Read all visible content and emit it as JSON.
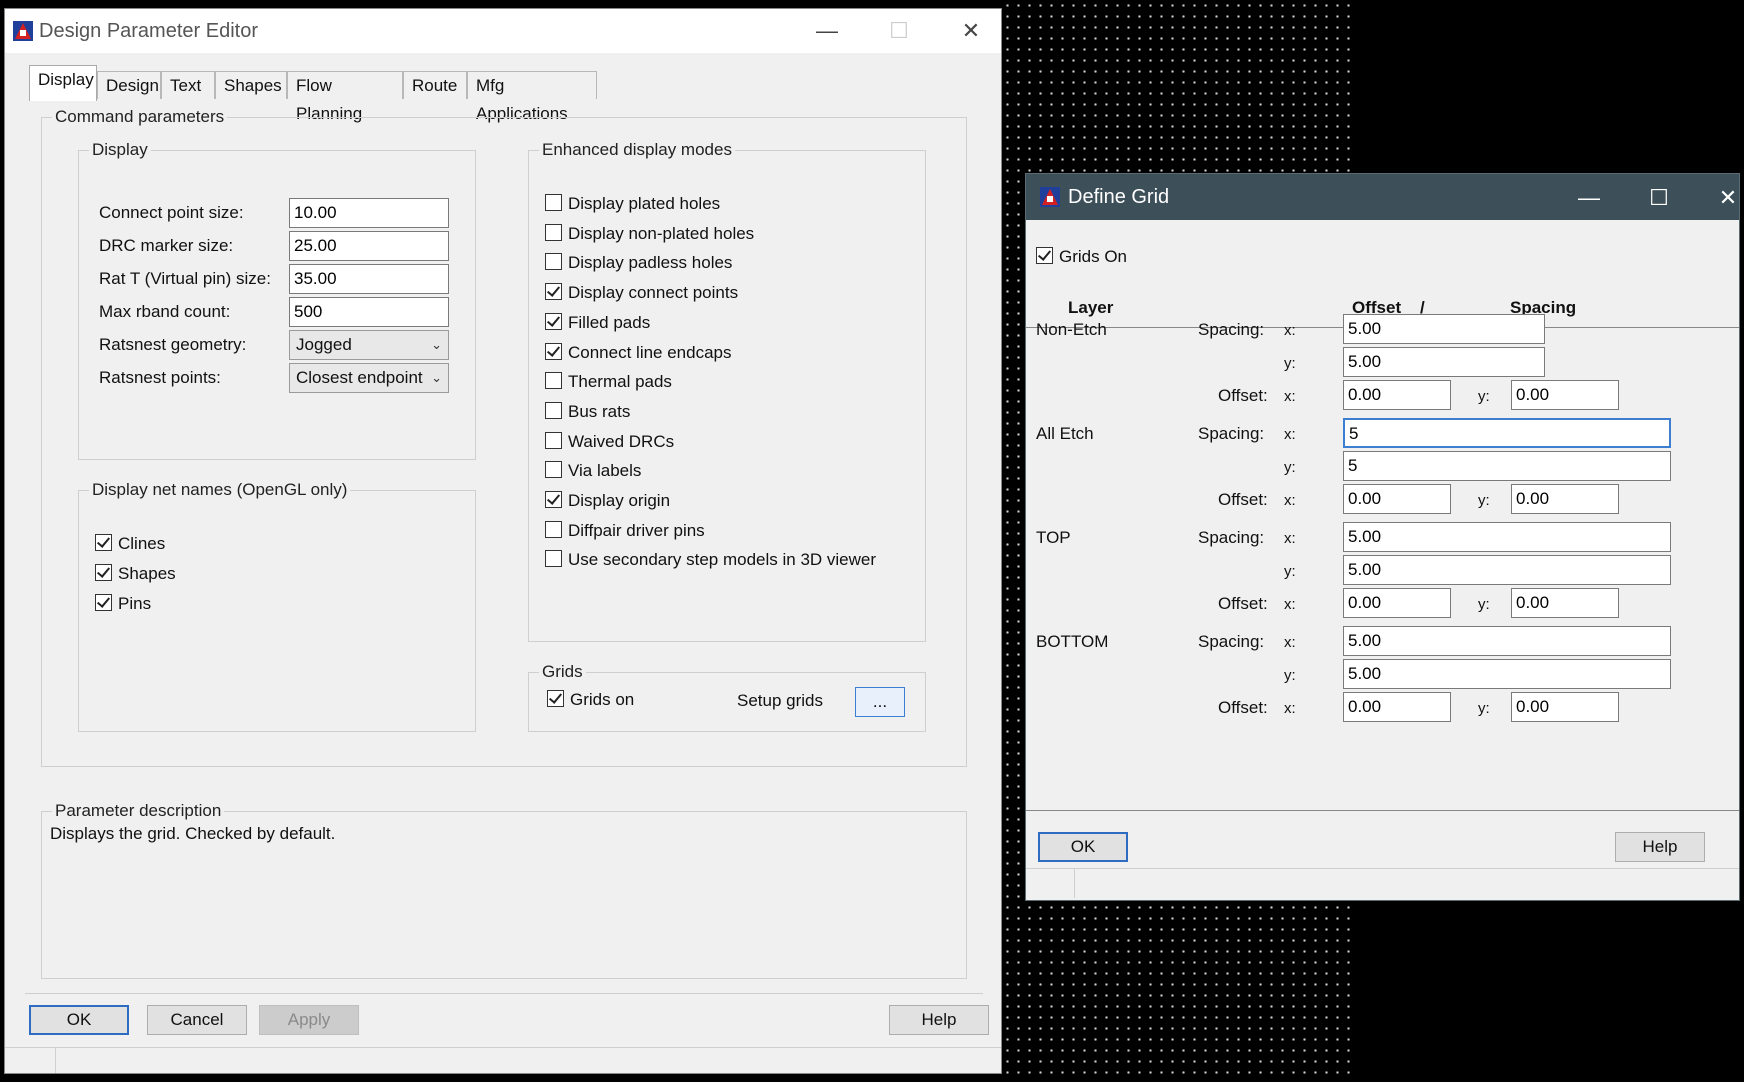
{
  "main": {
    "title": "Design Parameter Editor",
    "tabs": [
      "Display",
      "Design",
      "Text",
      "Shapes",
      "Flow Planning",
      "Route",
      "Mfg Applications"
    ],
    "command_group": "Command parameters",
    "display_group": "Display",
    "fields": {
      "connect_point_label": "Connect point size:",
      "connect_point_value": "10.00",
      "drc_marker_label": "DRC marker size:",
      "drc_marker_value": "25.00",
      "rat_t_label": "Rat T (Virtual pin) size:",
      "rat_t_value": "35.00",
      "max_rband_label": "Max rband count:",
      "max_rband_value": "500",
      "ratsnest_geom_label": "Ratsnest geometry:",
      "ratsnest_geom_value": "Jogged",
      "ratsnest_points_label": "Ratsnest points:",
      "ratsnest_points_value": "Closest endpoint"
    },
    "net_names_group": "Display net names (OpenGL only)",
    "net_names": [
      {
        "label": "Clines",
        "checked": true
      },
      {
        "label": "Shapes",
        "checked": true
      },
      {
        "label": "Pins",
        "checked": true
      }
    ],
    "enhanced_group": "Enhanced display modes",
    "enhanced": [
      {
        "label": "Display plated holes",
        "checked": false
      },
      {
        "label": "Display non-plated holes",
        "checked": false
      },
      {
        "label": "Display padless holes",
        "checked": false
      },
      {
        "label": "Display connect points",
        "checked": true
      },
      {
        "label": "Filled pads",
        "checked": true
      },
      {
        "label": "Connect line endcaps",
        "checked": true
      },
      {
        "label": "Thermal pads",
        "checked": false
      },
      {
        "label": "Bus rats",
        "checked": false
      },
      {
        "label": "Waived DRCs",
        "checked": false
      },
      {
        "label": "Via labels",
        "checked": false
      },
      {
        "label": "Display origin",
        "checked": true
      },
      {
        "label": "Diffpair driver pins",
        "checked": false
      },
      {
        "label": "Use secondary step models in 3D viewer",
        "checked": false
      }
    ],
    "grids_group": "Grids",
    "grids_on_label": "Grids on",
    "grids_on_checked": true,
    "setup_grids_label": "Setup grids",
    "setup_grids_button": "...",
    "param_desc_group": "Parameter description",
    "param_desc_text": "Displays the grid. Checked by default.",
    "buttons": {
      "ok": "OK",
      "cancel": "Cancel",
      "apply": "Apply",
      "help": "Help"
    }
  },
  "grid": {
    "title": "Define Grid",
    "grids_on_label": "Grids On",
    "grids_on_checked": true,
    "header_layer": "Layer",
    "header_offset": "Offset",
    "header_slash": "/",
    "header_spacing": "Spacing",
    "spacing_label": "Spacing:",
    "offset_label": "Offset:",
    "x_label": "x:",
    "y_label": "y:",
    "layers": [
      {
        "name": "Non-Etch",
        "spacing_x": "5.00",
        "spacing_y": "5.00",
        "offset_x": "0.00",
        "offset_y": "0.00"
      },
      {
        "name": "All Etch",
        "spacing_x": "5",
        "spacing_y": "5",
        "offset_x": "0.00",
        "offset_y": "0.00"
      },
      {
        "name": "TOP",
        "spacing_x": "5.00",
        "spacing_y": "5.00",
        "offset_x": "0.00",
        "offset_y": "0.00"
      },
      {
        "name": "BOTTOM",
        "spacing_x": "5.00",
        "spacing_y": "5.00",
        "offset_x": "0.00",
        "offset_y": "0.00"
      }
    ],
    "buttons": {
      "ok": "OK",
      "help": "Help"
    }
  }
}
